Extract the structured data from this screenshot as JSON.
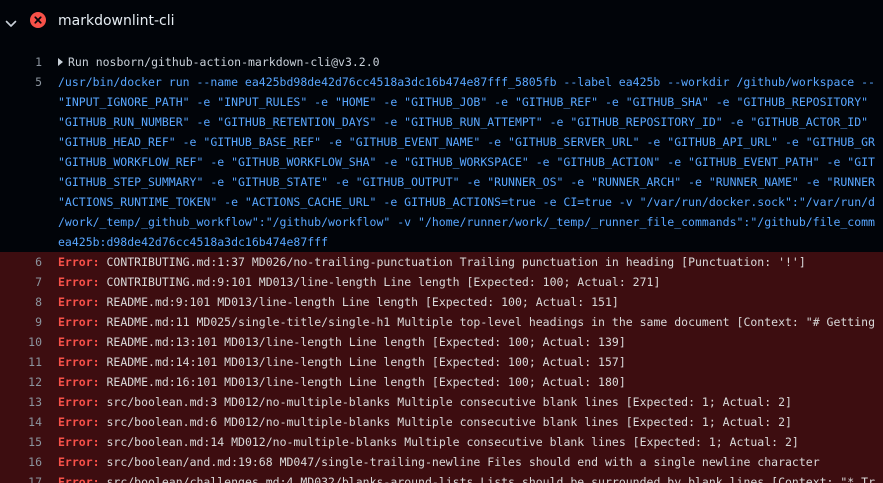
{
  "colors": {
    "background": "#010409",
    "error_background": "#3d0d10",
    "error_label": "#f85149",
    "command_text": "#58a6ff",
    "line_number": "#8b949e",
    "failure_icon": "#f85149"
  },
  "header": {
    "toggle_icon": "chevron-down-icon",
    "status_icon": "x-circle-fill-icon",
    "title": "markdownlint-cli"
  },
  "log": {
    "group": {
      "number": "1",
      "text": "Run nosborn/github-action-markdown-cli@v3.2.0"
    },
    "command": {
      "number": "5",
      "lines": [
        "/usr/bin/docker run --name ea425bd98de42d76cc4518a3dc16b474e87fff_5805fb --label ea425b --workdir /github/workspace --",
        "\"INPUT_IGNORE_PATH\" -e \"INPUT_RULES\" -e \"HOME\" -e \"GITHUB_JOB\" -e \"GITHUB_REF\" -e \"GITHUB_SHA\" -e \"GITHUB_REPOSITORY\"",
        "\"GITHUB_RUN_NUMBER\" -e \"GITHUB_RETENTION_DAYS\" -e \"GITHUB_RUN_ATTEMPT\" -e \"GITHUB_REPOSITORY_ID\" -e \"GITHUB_ACTOR_ID\"",
        "\"GITHUB_HEAD_REF\" -e \"GITHUB_BASE_REF\" -e \"GITHUB_EVENT_NAME\" -e \"GITHUB_SERVER_URL\" -e \"GITHUB_API_URL\" -e \"GITHUB_GR",
        "\"GITHUB_WORKFLOW_REF\" -e \"GITHUB_WORKFLOW_SHA\" -e \"GITHUB_WORKSPACE\" -e \"GITHUB_ACTION\" -e \"GITHUB_EVENT_PATH\" -e \"GIT",
        "\"GITHUB_STEP_SUMMARY\" -e \"GITHUB_STATE\" -e \"GITHUB_OUTPUT\" -e \"RUNNER_OS\" -e \"RUNNER_ARCH\" -e \"RUNNER_NAME\" -e \"RUNNER",
        "\"ACTIONS_RUNTIME_TOKEN\" -e \"ACTIONS_CACHE_URL\" -e GITHUB_ACTIONS=true -e CI=true -v \"/var/run/docker.sock\":\"/var/run/d",
        "/work/_temp/_github_workflow\":\"/github/workflow\" -v \"/home/runner/work/_temp/_runner_file_commands\":\"/github/file_comm",
        "ea425b:d98de42d76cc4518a3dc16b474e87fff"
      ]
    },
    "error_label": "Error:",
    "errors": [
      {
        "number": "6",
        "message": "CONTRIBUTING.md:1:37 MD026/no-trailing-punctuation Trailing punctuation in heading [Punctuation: '!']"
      },
      {
        "number": "7",
        "message": "CONTRIBUTING.md:9:101 MD013/line-length Line length [Expected: 100; Actual: 271]"
      },
      {
        "number": "8",
        "message": "README.md:9:101 MD013/line-length Line length [Expected: 100; Actual: 151]"
      },
      {
        "number": "9",
        "message": "README.md:11 MD025/single-title/single-h1 Multiple top-level headings in the same document [Context: \"# Getting"
      },
      {
        "number": "10",
        "message": "README.md:13:101 MD013/line-length Line length [Expected: 100; Actual: 139]"
      },
      {
        "number": "11",
        "message": "README.md:14:101 MD013/line-length Line length [Expected: 100; Actual: 157]"
      },
      {
        "number": "12",
        "message": "README.md:16:101 MD013/line-length Line length [Expected: 100; Actual: 180]"
      },
      {
        "number": "13",
        "message": "src/boolean.md:3 MD012/no-multiple-blanks Multiple consecutive blank lines [Expected: 1; Actual: 2]"
      },
      {
        "number": "14",
        "message": "src/boolean.md:6 MD012/no-multiple-blanks Multiple consecutive blank lines [Expected: 1; Actual: 2]"
      },
      {
        "number": "15",
        "message": "src/boolean.md:14 MD012/no-multiple-blanks Multiple consecutive blank lines [Expected: 1; Actual: 2]"
      },
      {
        "number": "16",
        "message": "src/boolean/and.md:19:68 MD047/single-trailing-newline Files should end with a single newline character"
      },
      {
        "number": "17",
        "message": "src/boolean/challenges.md:4 MD032/blanks-around-lists Lists should be surrounded by blank lines [Context: \"* Tr"
      }
    ]
  }
}
